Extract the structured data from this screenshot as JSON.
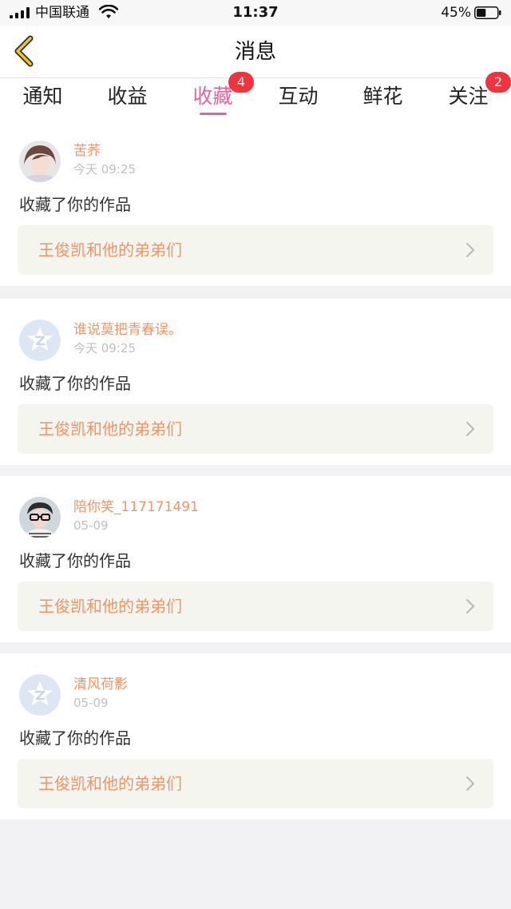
{
  "status_bar": {
    "carrier": "中国联通",
    "time": "11:37",
    "battery_percent": "45%",
    "battery_level": 0.45
  },
  "nav": {
    "title": "消息",
    "back_icon": "chevron-left-icon",
    "accent_color": "#f5c518"
  },
  "tabs": [
    {
      "label": "通知",
      "badge": "",
      "active": false
    },
    {
      "label": "收益",
      "badge": "",
      "active": false
    },
    {
      "label": "收藏",
      "badge": "4",
      "active": true
    },
    {
      "label": "互动",
      "badge": "",
      "active": false
    },
    {
      "label": "鲜花",
      "badge": "",
      "active": false
    },
    {
      "label": "关注",
      "badge": "2",
      "active": false
    }
  ],
  "colors": {
    "active_tab": "#e6649b",
    "badge": "#f0343e",
    "username": "#ef9566",
    "work_title": "#ef9566",
    "work_bg": "#f5f5ef"
  },
  "feed": [
    {
      "username": "苦荞",
      "time": "今天 09:25",
      "action": "收藏了你的作品",
      "work": "王俊凯和他的弟弟们",
      "avatar": "photo-avatar"
    },
    {
      "username": "谁说莫把青春误。",
      "time": "今天 09:25",
      "action": "收藏了你的作品",
      "work": "王俊凯和他的弟弟们",
      "avatar": "default-avatar"
    },
    {
      "username": "陪你笑_117171491",
      "time": "05-09",
      "action": "收藏了你的作品",
      "work": "王俊凯和他的弟弟们",
      "avatar": "photo-avatar"
    },
    {
      "username": "清风荷影",
      "time": "05-09",
      "action": "收藏了你的作品",
      "work": "王俊凯和他的弟弟们",
      "avatar": "default-avatar"
    }
  ]
}
